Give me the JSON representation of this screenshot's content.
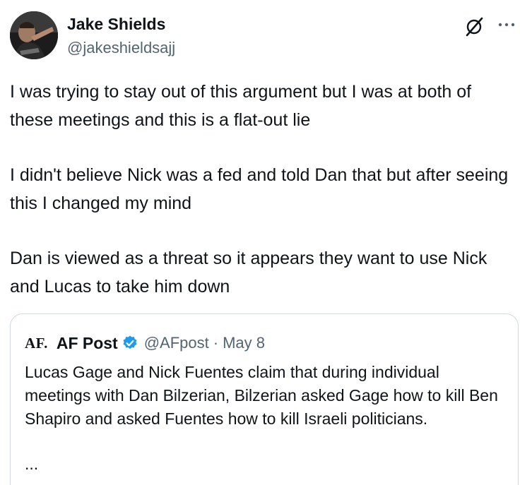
{
  "author": {
    "name": "Jake Shields",
    "handle": "@jakeshieldsajj"
  },
  "tweet": {
    "paragraphs": [
      "I was trying to stay out of this argument but I was at both of these meetings and this is a flat-out lie",
      "I didn't believe Nick was a fed and told Dan that but after seeing this I changed my mind",
      "Dan is viewed as a threat so it appears they want to use Nick and Lucas to take him down"
    ]
  },
  "quote": {
    "logo": "AF.",
    "name": "AF Post",
    "handle": "@AFpost",
    "separator": "·",
    "date": "May 8",
    "text": "Lucas Gage and Nick Fuentes claim that during individual meetings with Dan Bilzerian, Bilzerian asked Gage how to kill Ben Shapiro and asked Fuentes how to kill Israeli politicians.",
    "ellipsis": "..."
  },
  "icons": {
    "grok": "grok-icon",
    "more": "more-icon",
    "verified": "verified-badge-icon"
  },
  "colors": {
    "text": "#0f1419",
    "secondary": "#536471",
    "border": "#cfd9de",
    "verified": "#1d9bf0"
  }
}
